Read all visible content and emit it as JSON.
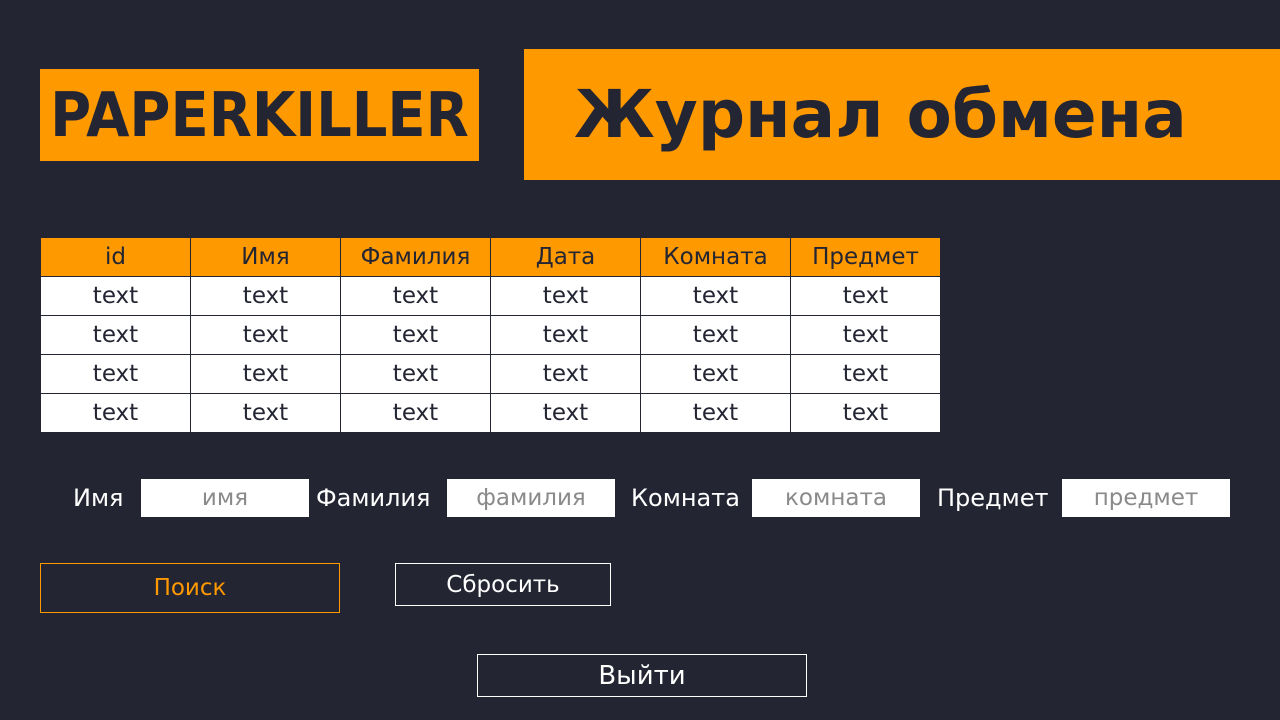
{
  "logo": {
    "text": "PAPERKILLER"
  },
  "header": {
    "title": "Журнал обмена"
  },
  "table": {
    "columns": [
      "id",
      "Имя",
      "Фамилия",
      "Дата",
      "Комната",
      "Предмет"
    ],
    "rows": [
      [
        "text",
        "text",
        "text",
        "text",
        "text",
        "text"
      ],
      [
        "text",
        "text",
        "text",
        "text",
        "text",
        "text"
      ],
      [
        "text",
        "text",
        "text",
        "text",
        "text",
        "text"
      ],
      [
        "text",
        "text",
        "text",
        "text",
        "text",
        "text"
      ]
    ]
  },
  "filters": {
    "first_name_label": "Имя",
    "first_name_placeholder": "имя",
    "first_name_value": "",
    "last_name_label": "Фамилия",
    "last_name_placeholder": "фамилия",
    "last_name_value": "",
    "room_label": "Комната",
    "room_placeholder": "комната",
    "room_value": "",
    "subject_label": "Предмет",
    "subject_placeholder": "предмет",
    "subject_value": ""
  },
  "actions": {
    "search_label": "Поиск",
    "reset_label": "Сбросить",
    "exit_label": "Выйти"
  },
  "colors": {
    "background": "#232532",
    "accent": "#FF9900",
    "text_dark": "#232532",
    "text_light": "#FFFFFF"
  }
}
